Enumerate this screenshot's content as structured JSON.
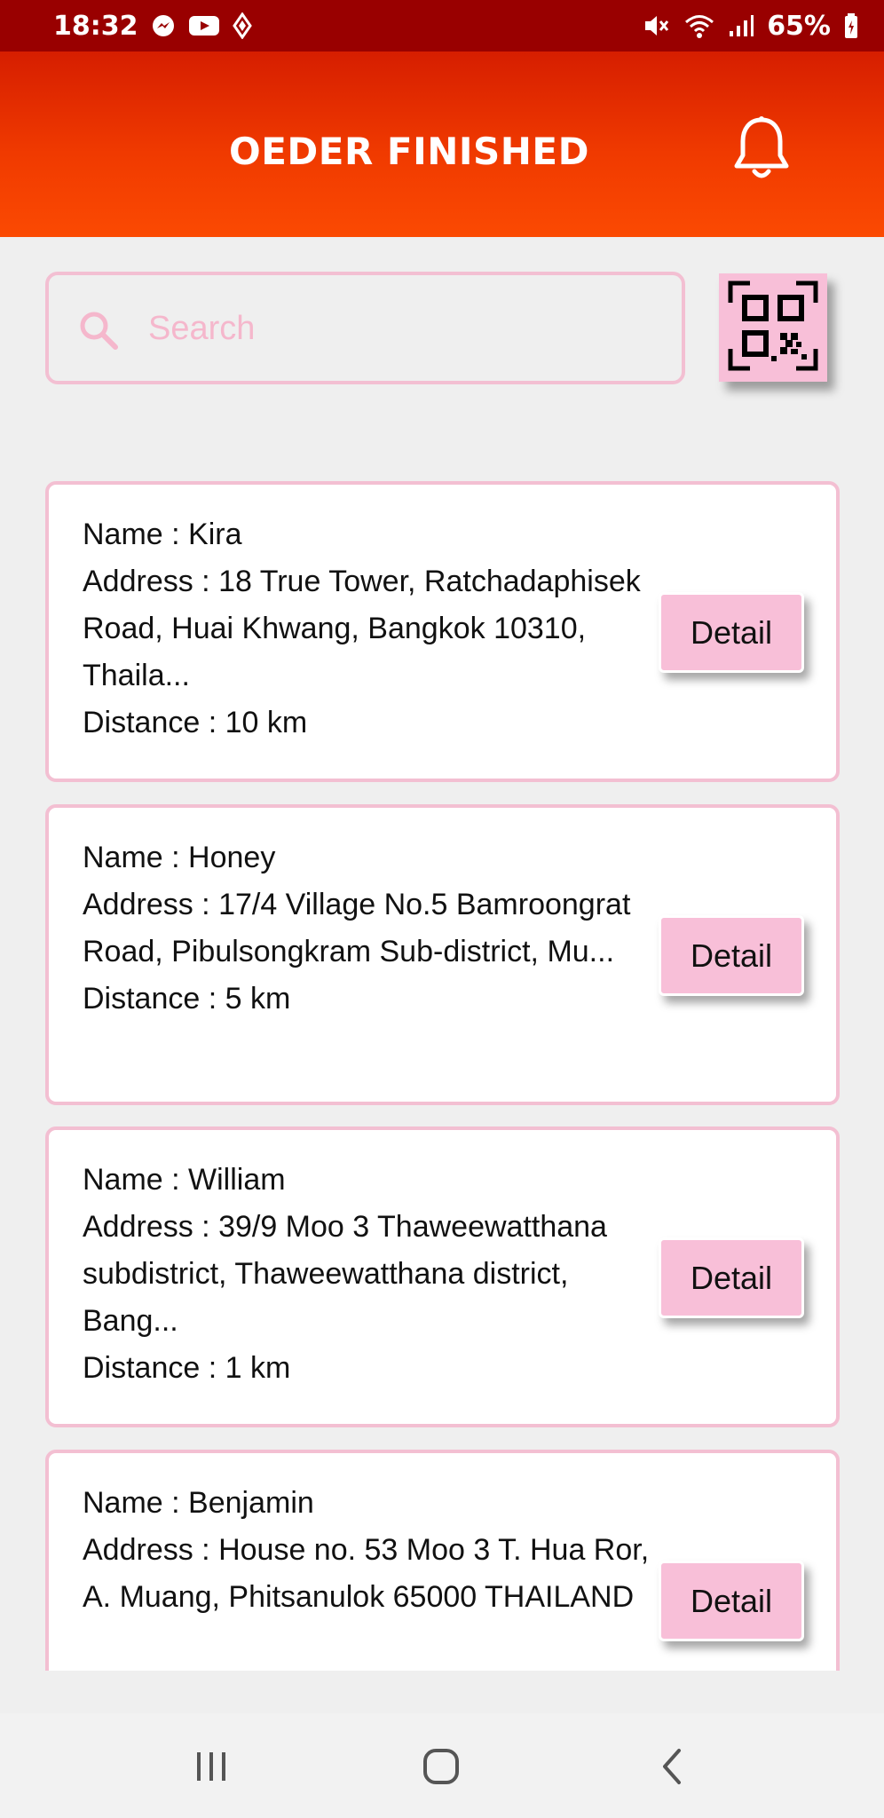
{
  "status_bar": {
    "time": "18:32",
    "battery": "65%",
    "left_icons": [
      "messenger-icon",
      "youtube-icon",
      "diamond-icon"
    ],
    "right_icons": [
      "mute-icon",
      "wifi-icon",
      "signal-icon",
      "battery-icon"
    ]
  },
  "header": {
    "title": "OEDER FINISHED",
    "notification_icon": "bell-icon"
  },
  "search": {
    "placeholder": "Search",
    "value": ""
  },
  "orders": [
    {
      "name_line": "Name : Kira",
      "address_line": "Address : 18 True Tower, Ratchadaphisek Road, Huai Khwang, Bangkok 10310, Thaila...",
      "distance_line": "Distance : 10 km",
      "detail_label": "Detail"
    },
    {
      "name_line": "Name : Honey",
      "address_line": "Address : 17/4 Village No.5 Bamroongrat Road, Pibulsongkram Sub-district, Mu...",
      "distance_line": "Distance : 5 km",
      "detail_label": "Detail"
    },
    {
      "name_line": "Name : William",
      "address_line": "Address : 39/9 Moo 3 Thaweewatthana subdistrict, Thaweewatthana district, Bang...",
      "distance_line": "Distance : 1 km",
      "detail_label": "Detail"
    },
    {
      "name_line": "Name : Benjamin",
      "address_line": "Address : House no. 53 Moo 3 T. Hua Ror, A. Muang, Phitsanulok 65000 THAILAND",
      "distance_line": "",
      "detail_label": "Detail"
    }
  ],
  "nav": {
    "recents_icon": "recents-icon",
    "home_icon": "home-icon",
    "back_icon": "back-icon"
  },
  "colors": {
    "status_bar": "#990000",
    "header_gradient_top": "#d61e00",
    "header_gradient_bottom": "#fb4a02",
    "accent_pink": "#f8bfd8",
    "border_pink": "#f3bfd2",
    "background": "#efefef"
  }
}
